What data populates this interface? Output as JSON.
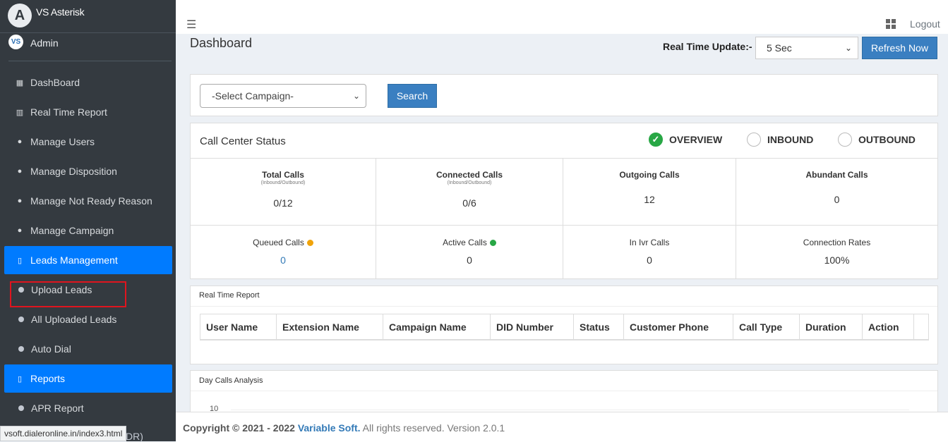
{
  "sidebar": {
    "brand_letter": "A",
    "brand_name": "VS Asterisk",
    "user_avatar": "VS",
    "user_name": "Admin",
    "items": [
      {
        "icon": "grid-icon",
        "glyph": "▦",
        "label": "DashBoard"
      },
      {
        "icon": "bar-chart-icon",
        "glyph": "▥",
        "label": "Real Time Report"
      },
      {
        "icon": "users-icon",
        "glyph": "●",
        "label": "Manage Users"
      },
      {
        "icon": "user-icon",
        "glyph": "●",
        "label": "Manage Disposition"
      },
      {
        "icon": "user-icon",
        "glyph": "●",
        "label": "Manage Not Ready Reason"
      },
      {
        "icon": "user-icon",
        "glyph": "●",
        "label": "Manage Campaign"
      },
      {
        "icon": "folder-icon",
        "glyph": "▯",
        "label": "Leads Management"
      },
      {
        "icon": "circle-icon",
        "label": "Upload Leads"
      },
      {
        "icon": "circle-icon",
        "label": "All Uploaded Leads"
      },
      {
        "icon": "circle-icon",
        "label": "Auto Dial"
      },
      {
        "icon": "folder-icon",
        "glyph": "▯",
        "label": "Reports"
      },
      {
        "icon": "circle-icon",
        "label": "APR Report"
      }
    ],
    "partial_item": "DR)",
    "status_url": "vsoft.dialeronline.in/index3.html"
  },
  "header": {
    "logout_label": "Logout"
  },
  "main": {
    "page_title": "Dashboard",
    "real_time_update_label": "Real Time Update:-",
    "real_time_update_value": "5 Sec",
    "refresh_label": "Refresh Now",
    "campaign_select_value": "-Select Campaign-",
    "search_label": "Search"
  },
  "call_center_status": {
    "title": "Call Center Status",
    "modes": [
      "OVERVIEW",
      "INBOUND",
      "OUTBOUND"
    ],
    "selected_mode": "OVERVIEW",
    "stats": [
      {
        "label": "Total Calls",
        "sub": "(Inbound/Outbound)",
        "value": "0/12"
      },
      {
        "label": "Connected Calls",
        "sub": "(Inbound/Outbound)",
        "value": "0/6"
      },
      {
        "label": "Outgoing Calls",
        "value": "12"
      },
      {
        "label": "Abundant Calls",
        "value": "0"
      },
      {
        "label": "Queued Calls",
        "value": "0"
      },
      {
        "label": "Active Calls",
        "value": "0"
      },
      {
        "label": "In Ivr Calls",
        "value": "0"
      },
      {
        "label": "Connection Rates",
        "value": "100%"
      }
    ],
    "colors": {
      "queued_dot": "#f0a30a",
      "active_dot": "#28a745",
      "check": "#28a745"
    }
  },
  "real_time_report": {
    "title": "Real Time Report",
    "columns": [
      "User Name",
      "Extension Name",
      "Campaign Name",
      "DID Number",
      "Status",
      "Customer Phone",
      "Call Type",
      "Duration",
      "Action"
    ]
  },
  "day_calls_analysis": {
    "title": "Day Calls Analysis",
    "y_tick": "10"
  },
  "footer": {
    "prefix": "Copyright © 2021 - 2022",
    "company": "Variable Soft.",
    "suffix": "All rights reserved. Version 2.0.1"
  },
  "theme": {
    "accent": "#007bff",
    "button": "#3a7fc1",
    "sidebar_bg": "#343a40",
    "highlight": "#e0141e"
  }
}
